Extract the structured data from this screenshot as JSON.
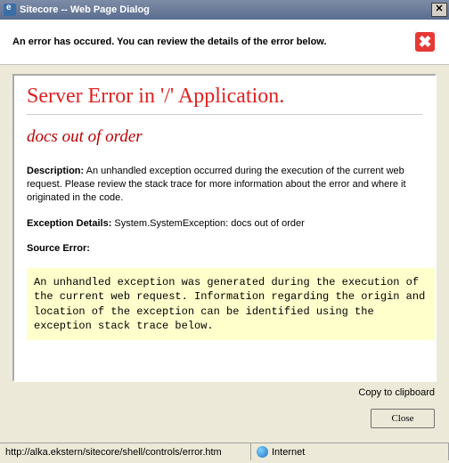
{
  "titlebar": {
    "title": "Sitecore -- Web Page Dialog"
  },
  "header": {
    "message": "An error has occured. You can review the details of the error below."
  },
  "error": {
    "title": "Server Error in '/' Application.",
    "subtitle": "docs out of order",
    "description_label": "Description:",
    "description_text": " An unhandled exception occurred during the execution of the current web request. Please review the stack trace for more information about the error and where it originated in the code.",
    "exception_label": "Exception Details:",
    "exception_text": " System.SystemException: docs out of order",
    "source_label": "Source Error:",
    "source_block": "An unhandled exception was generated during the execution of the current web request. Information regarding the origin and location of the exception can be identified using the exception stack trace below."
  },
  "actions": {
    "copy": "Copy to clipboard",
    "close": "Close"
  },
  "statusbar": {
    "url": "http://alka.ekstern/sitecore/shell/controls/error.htm",
    "zone": "Internet"
  }
}
